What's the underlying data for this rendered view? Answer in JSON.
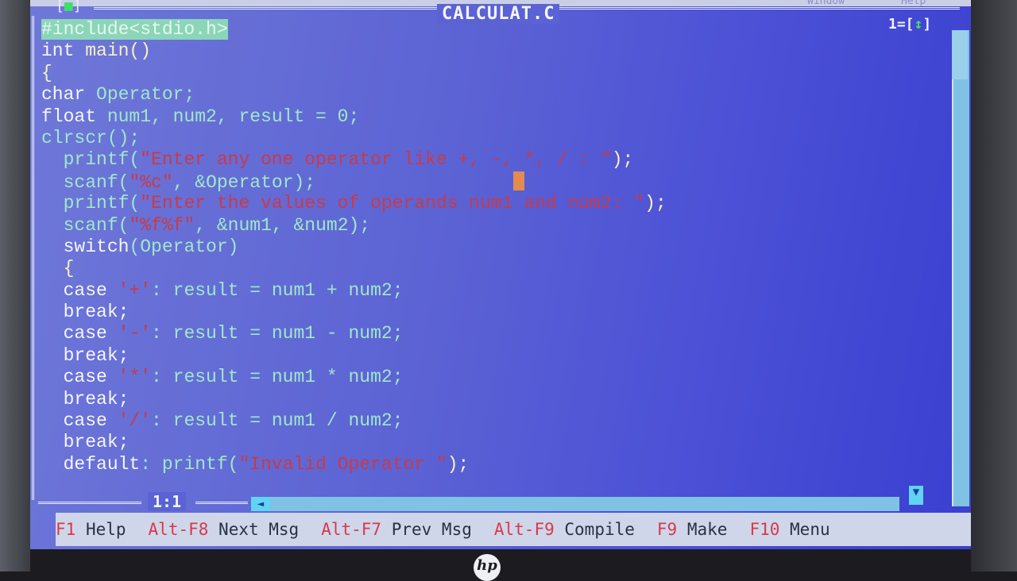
{
  "editor": {
    "file_name": "CALCULAT.C",
    "window_number": "1",
    "window_zoom_icon": "up-down-arrow-icon",
    "cursor_position": "1:1"
  },
  "code": {
    "l1": "#include<stdio.h>",
    "l2_kw": "int",
    "l2_id": " main()",
    "l3": "{",
    "l4_kw": "char",
    "l4_id": " Operator;",
    "l5_kw": "float",
    "l5_id": " num1, num2, result = 0;",
    "l6": "clrscr();",
    "l7_fn": "printf(",
    "l7_str": "\"Enter any one operator like +, -, *, / : \"",
    "l7_end": ");",
    "l8_fn": "scanf(",
    "l8_str": "\"%c\"",
    "l8_end": ", &Operator);",
    "l9_fn": "printf(",
    "l9_str": "\"Enter the values of operands num1 and num2: \"",
    "l9_end": ");",
    "l10_fn": "scanf(",
    "l10_str": "\"%f%f\"",
    "l10_end": ", &num1, &num2);",
    "l11_kw": "switch",
    "l11_id": "(Operator)",
    "l12": "{",
    "l13_kw": "case",
    "l13_str": " '+'",
    "l13_id": ": result = num1 + num2;",
    "l14": "break;",
    "l15_kw": "case",
    "l15_str": " '-'",
    "l15_id": ": result = num1 - num2;",
    "l16": "break;",
    "l17_kw": "case",
    "l17_str": " '*'",
    "l17_id": ": result = num1 * num2;",
    "l18": "break;",
    "l19_kw": "case",
    "l19_str": " '/'",
    "l19_id": ": result = num1 / num2;",
    "l20": "break;",
    "l21_kw": "default",
    "l21_id": ": printf(",
    "l21_str": "\"Invalid Operator \"",
    "l21_end": ");"
  },
  "function_keys": [
    {
      "key": "F1",
      "label": "Help"
    },
    {
      "key": "Alt-F8",
      "label": "Next Msg"
    },
    {
      "key": "Alt-F7",
      "label": "Prev Msg"
    },
    {
      "key": "Alt-F9",
      "label": "Compile"
    },
    {
      "key": "F9",
      "label": "Make"
    },
    {
      "key": "F10",
      "label": "Menu"
    }
  ],
  "menu": {
    "window": "Window",
    "help": "Help"
  },
  "bezel": {
    "logo": "hp"
  },
  "colors": {
    "editor_bg": "#5b62d4",
    "keyword": "#f4f6ff",
    "identifier": "#9fe8c9",
    "string": "#c83a4a",
    "fkey_bar": "#cfd6ea",
    "fkey_key": "#d8394a"
  }
}
